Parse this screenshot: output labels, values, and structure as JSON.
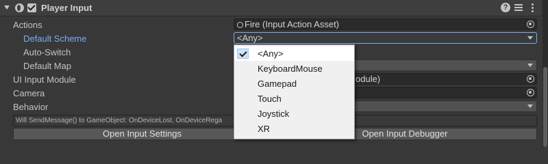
{
  "component": {
    "title": "Player Input",
    "enabled": true,
    "help_icon": "?"
  },
  "rows": {
    "actions": {
      "label": "Actions",
      "value": "Fire (Input Action Asset)"
    },
    "default_scheme": {
      "label": "Default Scheme",
      "value": "<Any>"
    },
    "auto_switch": {
      "label": "Auto-Switch"
    },
    "default_map": {
      "label": "Default Map"
    },
    "ui_input_module": {
      "label": "UI Input Module",
      "value_fragment": "odule)"
    },
    "camera": {
      "label": "Camera"
    },
    "behavior": {
      "label": "Behavior"
    }
  },
  "message": "Will SendMessage() to GameObject: OnDeviceLost, OnDeviceRega",
  "buttons": {
    "open_input_settings": "Open Input Settings",
    "open_input_debugger": "Open Input Debugger"
  },
  "scheme_dropdown": {
    "selected": "<Any>",
    "options": [
      "<Any>",
      "KeyboardMouse",
      "Gamepad",
      "Touch",
      "Joystick",
      "XR"
    ]
  },
  "colors": {
    "background": "#383838",
    "active_label": "#7babf0",
    "dropdown_bg": "#f0f0f0"
  }
}
